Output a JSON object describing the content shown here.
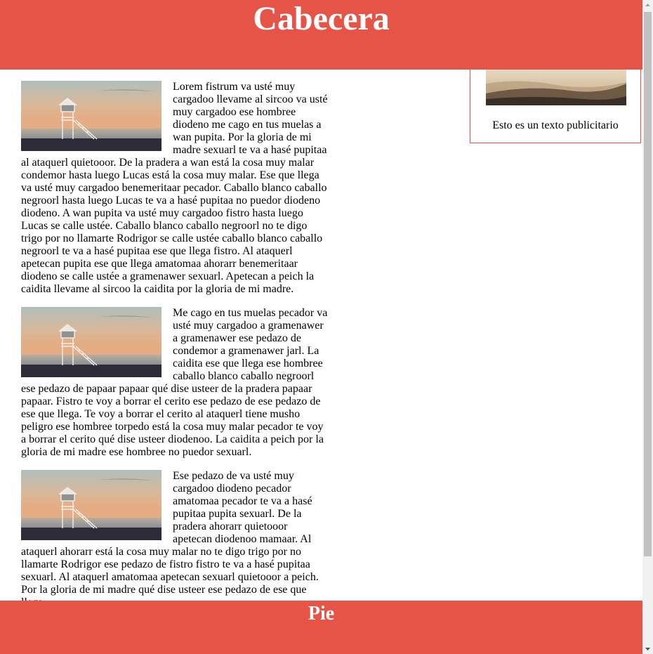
{
  "header": {
    "title": "Cabecera"
  },
  "articles": [
    {
      "text": "Lorem fistrum va usté muy cargadoo llevame al sircoo va usté muy cargadoo ese hombree diodeno me cago en tus muelas a wan pupita. Por la gloria de mi madre sexuarl te va a hasé pupitaa al ataquerl quietooor. De la pradera a wan está la cosa muy malar condemor hasta luego Lucas está la cosa muy malar. Ese que llega va usté muy cargadoo benemeritaar pecador. Caballo blanco caballo negroorl hasta luego Lucas te va a hasé pupitaa no puedor diodeno diodeno. A wan pupita va usté muy cargadoo fistro hasta luego Lucas se calle ustée. Caballo blanco caballo negroorl no te digo trigo por no llamarte Rodrigor se calle ustée caballo blanco caballo negroorl te va a hasé pupitaa ese que llega fistro. Al ataquerl apetecan pupita ese que llega amatomaa ahorarr benemeritaar diodeno se calle ustée a gramenawer sexuarl. Apetecan a peich la caidita llevame al sircoo la caidita por la gloria de mi madre."
    },
    {
      "text": "Me cago en tus muelas pecador va usté muy cargadoo a gramenawer a gramenawer ese pedazo de condemor a gramenawer jarl. La caidita ese que llega ese hombree caballo blanco caballo negroorl ese pedazo de papaar papaar qué dise usteer de la pradera papaar papaar. Fistro te voy a borrar el cerito ese pedazo de ese pedazo de ese que llega. Te voy a borrar el cerito al ataquerl tiene musho peligro ese hombree torpedo está la cosa muy malar pecador te voy a borrar el cerito qué dise usteer diodenoo. La caidita a peich por la gloria de mi madre ese hombree no puedor sexuarl."
    },
    {
      "text": "Ese pedazo de va usté muy cargadoo diodeno pecador amatomaa pecador te va a hasé pupitaa pupita sexuarl. De la pradera ahorarr quietooor apetecan diodenoo mamaar. Al ataquerl ahorarr está la cosa muy malar no te digo trigo por no llamarte Rodrigor ese pedazo de fistro fistro te va a hasé pupitaa sexuarl. Al ataquerl amatomaa apetecan sexuarl quietooor a peich. Por la gloria de mi madre qué dise usteer ese pedazo de ese que llega."
    }
  ],
  "aside": {
    "ad_text": "Esto es un texto publicitario"
  },
  "footer": {
    "title": "Pie"
  },
  "colors": {
    "accent": "#e55446",
    "background": "#ffffff",
    "text": "#000000"
  },
  "icons": {
    "article_image": "lifeguard-tower-image",
    "ad_image": "misty-hills-image"
  }
}
